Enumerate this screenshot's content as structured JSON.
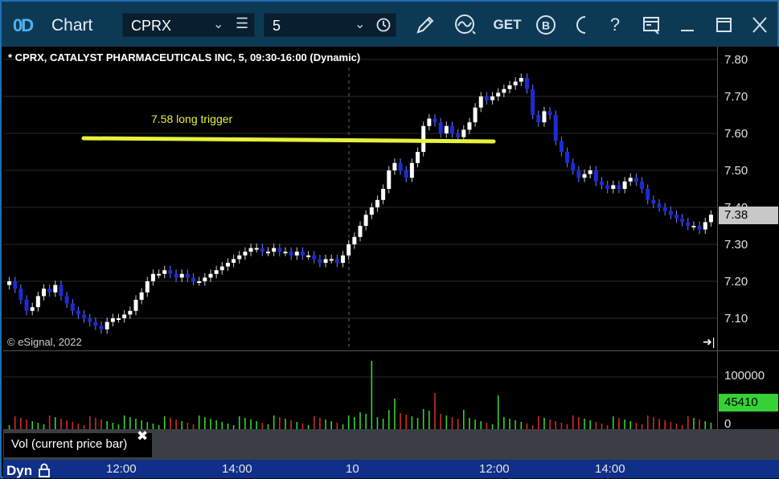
{
  "app": {
    "title": "Chart",
    "logo_glyph": "0D"
  },
  "toolbar": {
    "symbol": "CPRX",
    "interval": "5",
    "get_label": "GET",
    "b_label": "B",
    "help_label": "?"
  },
  "chart": {
    "title": "* CPRX, CATALYST PHARMACEUTICALS INC, 5, 09:30-16:00 (Dynamic)",
    "copyright": "© eSignal, 2022",
    "trigger_label": "7.58 long trigger",
    "last_price": "7.38",
    "y_ticks": [
      "7.80",
      "7.70",
      "7.60",
      "7.50",
      "7.40",
      "7.30",
      "7.20",
      "7.10"
    ],
    "x_ticks": [
      "12:00",
      "14:00",
      "10",
      "12:00",
      "14:00"
    ],
    "mode_label": "Dyn",
    "colors": {
      "up": "#ffffff",
      "down": "#1a2cd6",
      "trigger": "#e6f23a",
      "vol_up": "#35d135",
      "vol_down": "#d12a2a"
    }
  },
  "volume": {
    "label": "Vol (current price bar)",
    "close_glyph": "✖",
    "y_ticks": [
      "100000",
      "0"
    ],
    "last_value": "45410"
  },
  "chart_data": {
    "type": "candlestick",
    "trigger_level": 7.58,
    "ylim": [
      7.04,
      7.82
    ],
    "close_series": [
      7.2,
      7.18,
      7.15,
      7.12,
      7.13,
      7.16,
      7.18,
      7.17,
      7.19,
      7.16,
      7.14,
      7.12,
      7.11,
      7.1,
      7.09,
      7.08,
      7.07,
      7.09,
      7.1,
      7.1,
      7.11,
      7.12,
      7.15,
      7.17,
      7.2,
      7.22,
      7.22,
      7.23,
      7.22,
      7.21,
      7.22,
      7.21,
      7.2,
      7.2,
      7.21,
      7.22,
      7.23,
      7.24,
      7.25,
      7.26,
      7.27,
      7.28,
      7.29,
      7.29,
      7.28,
      7.28,
      7.29,
      7.28,
      7.28,
      7.27,
      7.28,
      7.27,
      7.27,
      7.26,
      7.25,
      7.26,
      7.26,
      7.25,
      7.27,
      7.3,
      7.32,
      7.35,
      7.38,
      7.4,
      7.42,
      7.45,
      7.5,
      7.52,
      7.5,
      7.48,
      7.52,
      7.55,
      7.62,
      7.64,
      7.63,
      7.6,
      7.62,
      7.6,
      7.59,
      7.61,
      7.63,
      7.67,
      7.7,
      7.69,
      7.7,
      7.71,
      7.72,
      7.73,
      7.74,
      7.75,
      7.72,
      7.65,
      7.63,
      7.66,
      7.65,
      7.58,
      7.55,
      7.52,
      7.5,
      7.48,
      7.49,
      7.5,
      7.47,
      7.46,
      7.45,
      7.46,
      7.45,
      7.47,
      7.48,
      7.47,
      7.45,
      7.42,
      7.41,
      7.4,
      7.39,
      7.38,
      7.37,
      7.36,
      7.35,
      7.35,
      7.34,
      7.36,
      7.38
    ],
    "volume_spike_at": "10:00 second session, ~100000+"
  }
}
